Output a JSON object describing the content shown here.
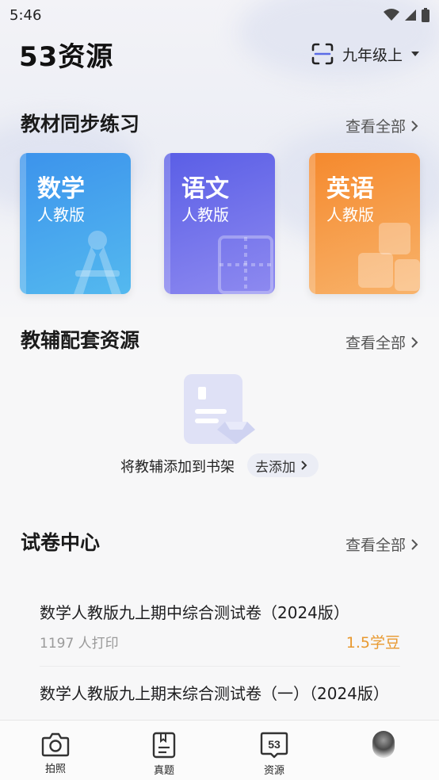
{
  "status": {
    "time": "5:46"
  },
  "header": {
    "title": "53资源",
    "grade": "九年级上"
  },
  "textbooks": {
    "title": "教材同步练习",
    "view_all": "查看全部",
    "cards": [
      {
        "subject": "数学",
        "edition": "人教版"
      },
      {
        "subject": "语文",
        "edition": "人教版"
      },
      {
        "subject": "英语",
        "edition": "人教版"
      }
    ]
  },
  "supplementary": {
    "title": "教辅配套资源",
    "view_all": "查看全部",
    "empty_text": "将教辅添加到书架",
    "add_label": "去添加"
  },
  "papers": {
    "title": "试卷中心",
    "view_all": "查看全部",
    "items": [
      {
        "title": "数学人教版九上期中综合测试卷（2024版）",
        "prints": "1197 人打印",
        "price": "1.5学豆"
      },
      {
        "title": "数学人教版九上期末综合测试卷（一）（2024版）"
      }
    ]
  },
  "tabbar": {
    "items": [
      {
        "label": "拍照"
      },
      {
        "label": "真题"
      },
      {
        "label": "资源",
        "icon_text": "53"
      }
    ]
  },
  "colors": {
    "math": "#3c93ec",
    "chinese": "#5a5ee6",
    "english": "#f5892d",
    "price": "#e8992f"
  }
}
